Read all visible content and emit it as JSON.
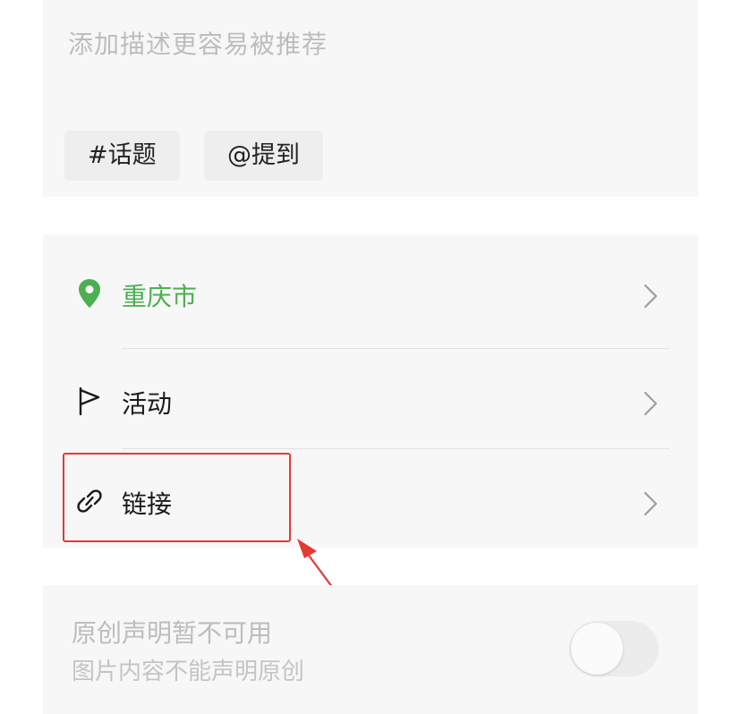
{
  "description": {
    "placeholder": "添加描述更容易被推荐",
    "chips": {
      "topic": "#话题",
      "mention": "@提到"
    }
  },
  "options": {
    "location": {
      "label": "重庆市",
      "icon": "location-pin-icon",
      "color": "#4caf50"
    },
    "activity": {
      "label": "活动",
      "icon": "flag-icon"
    },
    "link": {
      "label": "链接",
      "icon": "link-icon"
    }
  },
  "originality": {
    "title": "原创声明暂不可用",
    "subtitle": "图片内容不能声明原创",
    "toggle_on": false
  },
  "annotation": {
    "highlight_color": "#e53935"
  }
}
